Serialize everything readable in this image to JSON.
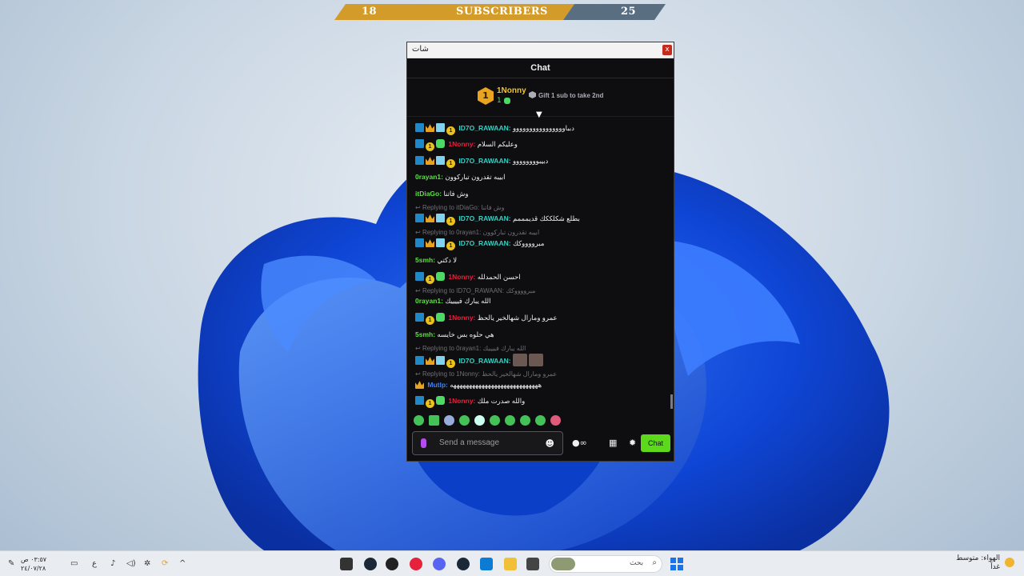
{
  "banner": {
    "left_count": "18",
    "label": "SUBSCRIBERS",
    "right_count": "25"
  },
  "window": {
    "title": "شات",
    "close_label": "x"
  },
  "chat": {
    "header": "Chat",
    "leaderboard": {
      "rank": "1",
      "top_user": "1Nonny",
      "top_count": "1",
      "gift_text": "Gift 1 sub to take 2nd"
    },
    "messages": [
      {
        "user": "ID7O_RAWAAN:",
        "text": "دبباوووووووووووووووو",
        "class": "u-rawaan"
      },
      {
        "user": "1Nonny:",
        "text": "وعليكم السلام",
        "class": "u-nonny"
      },
      {
        "user": "ID7O_RAWAAN:",
        "text": "دبيبوووووووو",
        "class": "u-rawaan"
      },
      {
        "user": "0rayan1:",
        "text": "ابيبه تقدرون تباركوون",
        "class": "u-green"
      },
      {
        "user": "itDiaGo:",
        "text": "وش فاتنا",
        "class": "u-green"
      },
      {
        "reply": "Replying to itDiaGo: وش فاتنا"
      },
      {
        "user": "ID7O_RAWAAN:",
        "text": "بطلع شكلككك قديمممم",
        "class": "u-rawaan"
      },
      {
        "reply": "Replying to 0rayan1: ابيبه تقدرون تباركوون"
      },
      {
        "user": "ID7O_RAWAAN:",
        "text": "مبرووووكك",
        "class": "u-rawaan"
      },
      {
        "user": "5smh:",
        "text": "لا دكتي",
        "class": "u-green"
      },
      {
        "user": "1Nonny:",
        "text": "احسن الحمدلله",
        "class": "u-nonny"
      },
      {
        "reply": "Replying to ID7O_RAWAAN: مبرووووكك"
      },
      {
        "user": "0rayan1:",
        "text": "الله يبارك فييييك",
        "class": "u-green"
      },
      {
        "user": "1Nonny:",
        "text": "عمرو ومارال شهالخير يالحظ",
        "class": "u-nonny"
      },
      {
        "user": "5smh:",
        "text": "هي حلوه بس خايسه",
        "class": "u-green"
      },
      {
        "reply": "Replying to 0rayan1: الله يبارك فييييك"
      },
      {
        "user": "ID7O_RAWAAN:",
        "text": "",
        "class": "u-rawaan"
      },
      {
        "reply": "Replying to 1Nonny: عمرو ومارال شهالخير يالحظ"
      },
      {
        "user": "Mutlp:",
        "text": "ههههههههههههههههههههههههههههه",
        "class": "u-blue"
      },
      {
        "user": "1Nonny:",
        "text": "والله صدرت ملك",
        "class": "u-nonny"
      }
    ],
    "input_placeholder": "Send a message",
    "chat_button": "Chat"
  },
  "taskbar": {
    "search_placeholder": "بحث",
    "weather_title": "الهواء: متوسط",
    "weather_sub": "غداً",
    "time": "٠٣:٥٧ ص",
    "date": "٢٤/٠٧/٢٨",
    "lang": "ع"
  },
  "colors": {
    "banner_gold": "#d39b2a",
    "banner_slate": "#5a6e82",
    "chat_bg": "#0e0e10",
    "chat_button": "#5bd91a"
  }
}
